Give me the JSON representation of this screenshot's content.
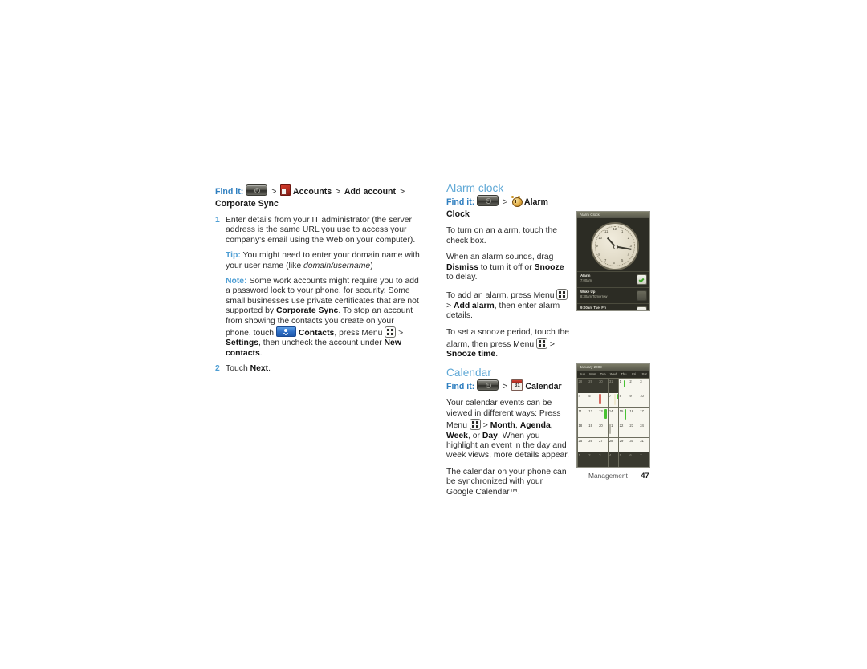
{
  "page": {
    "footer_section": "Management",
    "footer_page_number": "47",
    "accent_heading_color": "#5fa8d6",
    "accent_label_color": "#2f7fc0",
    "list_number_color": "#4e9ed4"
  },
  "left_column": {
    "findit": {
      "label": "Find it:",
      "icon1": "launcher-icon",
      "sep": ">",
      "icon2": "accounts-icon",
      "step1": "Accounts",
      "step2": "Add account",
      "step3": "Corporate Sync"
    },
    "steps": [
      {
        "number": "1",
        "text": "Enter details from your IT administrator (the server address is the same URL you use to access your company's email using the Web on your computer)."
      },
      {
        "number": "2",
        "text_prefix": "Touch ",
        "text_bold": "Next",
        "text_suffix": "."
      }
    ],
    "tip": {
      "label": "Tip:",
      "text_a": " You might need to enter your domain name with your user name (like ",
      "italic": "domain/username",
      "text_b": ")"
    },
    "note": {
      "label": "Note:",
      "text_a": " Some work accounts might require you to add a password lock to your phone, for security. Some small businesses use private certificates that are not supported by ",
      "bold_a": "Corporate Sync",
      "text_b": ". To stop an account from showing the contacts you create on your phone, touch ",
      "icon_contacts": "contacts-icon",
      "bold_b": "Contacts",
      "text_c": ", press Menu ",
      "icon_menu": "menu-icon",
      "text_d": " > ",
      "bold_c": "Settings",
      "text_e": ", then uncheck the account under ",
      "bold_d": "New contacts",
      "text_f": "."
    }
  },
  "right_column": {
    "alarm": {
      "heading": "Alarm clock",
      "findit": {
        "label": "Find it:",
        "icon1": "launcher-icon",
        "sep": ">",
        "icon2": "alarm-clock-icon",
        "target": "Alarm Clock"
      },
      "paragraphs": [
        {
          "plain": "To turn on an alarm, touch the check box."
        }
      ],
      "p_dismiss": {
        "a": "When an alarm sounds, drag ",
        "b1": "Dismiss",
        "c": " to turn it off or ",
        "b2": "Snooze",
        "d": " to delay."
      },
      "p_add": {
        "a": "To add an alarm, press Menu ",
        "icon_menu": "menu-icon",
        "b": " > ",
        "bold": "Add alarm",
        "c": ", then enter alarm details."
      },
      "p_snooze": {
        "a": "To set a snooze period, touch the alarm, then press Menu ",
        "icon_menu": "menu-icon",
        "b": " > ",
        "bold": "Snooze time",
        "c": "."
      }
    },
    "calendar": {
      "heading": "Calendar",
      "findit": {
        "label": "Find it:",
        "icon1": "launcher-icon",
        "sep": ">",
        "icon2": "calendar-icon",
        "target": "Calendar"
      },
      "p_views": {
        "a": "Your calendar events can be viewed in different ways: Press Menu ",
        "icon_menu": "menu-icon",
        "b": " > ",
        "bold1": "Month",
        "c": ", ",
        "bold2": "Agenda",
        "d": ", ",
        "bold3": "Week",
        "e": ", or ",
        "bold4": "Day",
        "f": ". When you highlight an event in the day and week views, more details appear."
      },
      "p_sync": "The calendar on your phone can be synchronized with your Google Calendar™."
    }
  },
  "screenshot_alarm": {
    "title": "Alarm Clock",
    "clock_numbers": [
      "12",
      "1",
      "2",
      "3",
      "4",
      "5",
      "6",
      "7",
      "8",
      "9",
      "10",
      "11"
    ],
    "rows": [
      {
        "name": "Alarm",
        "detail": "7:00am",
        "checked": true
      },
      {
        "name": "Wake Up",
        "detail": "8:30am Tomorrow",
        "checked": false
      },
      {
        "name": "9:00am Tue, Fri",
        "detail": "",
        "checked": true
      }
    ]
  },
  "screenshot_calendar": {
    "title": "January 2009",
    "weekdays": [
      "Sun",
      "Mon",
      "Tue",
      "Wed",
      "Thu",
      "Fri",
      "Sat"
    ],
    "weeks": [
      [
        {
          "d": "28",
          "other": true
        },
        {
          "d": "29",
          "other": true
        },
        {
          "d": "30",
          "other": true
        },
        {
          "d": "31",
          "other": true
        },
        {
          "d": "1"
        },
        {
          "d": "2"
        },
        {
          "d": "3"
        }
      ],
      [
        {
          "d": "4"
        },
        {
          "d": "5"
        },
        {
          "d": "6"
        },
        {
          "d": "7"
        },
        {
          "d": "8"
        },
        {
          "d": "9"
        },
        {
          "d": "10"
        }
      ],
      [
        {
          "d": "11"
        },
        {
          "d": "12"
        },
        {
          "d": "13"
        },
        {
          "d": "14"
        },
        {
          "d": "15"
        },
        {
          "d": "16"
        },
        {
          "d": "17"
        }
      ],
      [
        {
          "d": "18"
        },
        {
          "d": "19"
        },
        {
          "d": "20"
        },
        {
          "d": "21"
        },
        {
          "d": "22"
        },
        {
          "d": "23"
        },
        {
          "d": "24"
        }
      ],
      [
        {
          "d": "25"
        },
        {
          "d": "26"
        },
        {
          "d": "27"
        },
        {
          "d": "28"
        },
        {
          "d": "29"
        },
        {
          "d": "30"
        },
        {
          "d": "31"
        }
      ],
      [
        {
          "d": "1",
          "other": true
        },
        {
          "d": "2",
          "other": true
        },
        {
          "d": "3",
          "other": true
        },
        {
          "d": "4",
          "other": true
        },
        {
          "d": "5",
          "other": true
        },
        {
          "d": "6",
          "other": true
        },
        {
          "d": "7",
          "other": true
        }
      ]
    ]
  }
}
